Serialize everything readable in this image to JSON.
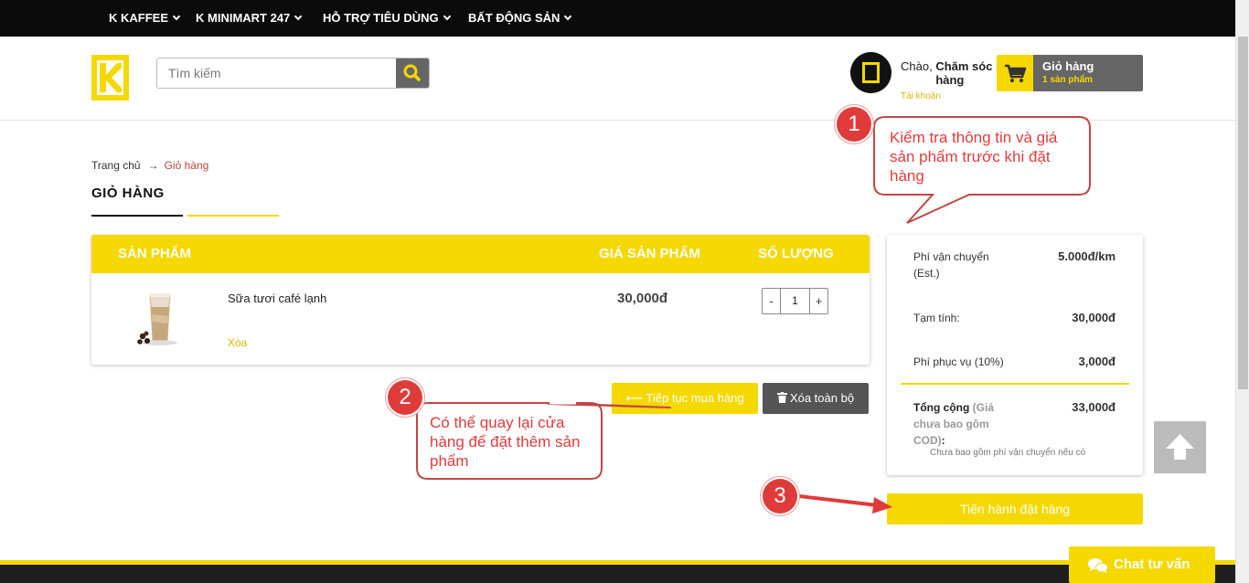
{
  "nav": {
    "items": [
      "K KAFFEE",
      "K MINIMART 247",
      "HỖ TRỢ TIÊU DÙNG",
      "BẤT ĐỘNG SẢN"
    ]
  },
  "search": {
    "placeholder": "Tìm kiếm"
  },
  "account": {
    "greeting_prefix": "Chào, ",
    "name": "Chăm sóc khách hàng",
    "link": "Tài khoản"
  },
  "cart": {
    "label": "Giỏ hàng",
    "count": "1 sản phẩm"
  },
  "breadcrumb": {
    "home": "Trang chủ",
    "arrow": "→",
    "current": "Giỏ hàng"
  },
  "page_title": "GIỎ HÀNG",
  "table": {
    "headers": {
      "product": "SẢN PHẨM",
      "price": "GIÁ SẢN PHẨM",
      "qty": "SỐ LƯỢNG"
    },
    "items": [
      {
        "name": "Sữa tươi café lạnh",
        "remove": "Xóa",
        "price": "30,000đ",
        "qty": "1",
        "minus": "-",
        "plus": "+"
      }
    ]
  },
  "actions": {
    "continue": "Tiếp tục mua hàng",
    "clear": "Xóa toàn bộ",
    "order": "Tiến hành đặt hàng"
  },
  "summary": {
    "shipping_label": "Phí vận chuyển (Est.)",
    "shipping_value": "5.000đ/km",
    "subtotal_label": "Tạm tính:",
    "subtotal_value": "30,000đ",
    "service_label": "Phí phục vụ (10%)",
    "service_value": "3,000đ",
    "total_label": "Tổng cộng",
    "total_note": "(Giá chưa bao gồm COD)",
    "total_colon": ":",
    "total_value": "33,000đ",
    "footnote": "Chưa bao gồm phí vận chuyển nếu có"
  },
  "chat": {
    "label": "Chat tư vấn"
  },
  "annotations": {
    "one": {
      "number": "1",
      "text": "Kiểm tra thông tin và giá sản phẩm trước khi đặt hàng"
    },
    "two": {
      "number": "2",
      "text": "Có thể quay lại cửa hàng để đặt thêm sản phẩm"
    },
    "three": {
      "number": "3"
    }
  },
  "colors": {
    "accent": "#f5d800",
    "dark": "#0b0b0b",
    "annotation": "#e03b3b",
    "button_gray": "#555555"
  }
}
